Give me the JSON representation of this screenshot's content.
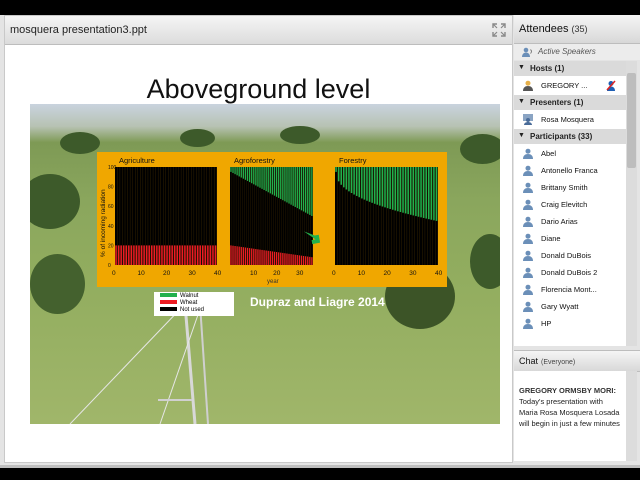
{
  "presentation": {
    "file_title": "mosquera presentation3.ppt",
    "slide_title": "Aboveground level",
    "citation": "Dupraz and Liagre 2014",
    "legend": [
      {
        "label": "Walnut",
        "color": "#22b14c"
      },
      {
        "label": "Wheat",
        "color": "#ed1c24"
      },
      {
        "label": "Not used",
        "color": "#000000"
      }
    ]
  },
  "chart_data": {
    "type": "bar",
    "ylabel": "% of incoming radiation",
    "xlabel": "year",
    "panels": [
      {
        "title": "Agriculture",
        "x_ticks": [
          "0",
          "10",
          "20",
          "30",
          "40"
        ]
      },
      {
        "title": "Agroforestry",
        "x_ticks": [
          "10",
          "20",
          "30"
        ]
      },
      {
        "title": "Forestry",
        "x_ticks": [
          "0",
          "10",
          "20",
          "30",
          "40"
        ]
      }
    ],
    "y_ticks": [
      "0",
      "20",
      "40",
      "60",
      "80",
      "100"
    ],
    "series_colors": {
      "walnut": "#22b14c",
      "wheat": "#ed1c24",
      "not_used": "#000000"
    }
  },
  "attendees": {
    "title": "Attendees",
    "count": "(35)",
    "active_speakers": "Active Speakers",
    "sections": [
      {
        "label": "Hosts (1)",
        "people": [
          "GREGORY ..."
        ]
      },
      {
        "label": "Presenters (1)",
        "people": [
          "Rosa Mosquera"
        ]
      },
      {
        "label": "Participants (33)",
        "people": [
          "Abel",
          "Antonello Franca",
          "Brittany Smith",
          "Craig Elevitch",
          "Dario Arias",
          "Diane",
          "Donald DuBois",
          "Donald DuBois 2",
          "Florencia Mont...",
          "Gary Wyatt",
          "HP"
        ]
      }
    ]
  },
  "chat": {
    "title": "Chat",
    "scope": "(Everyone)",
    "sender": "GREGORY ORMSBY MORI:",
    "message": "Today's presentation with Maria Rosa Mosquera Losada will begin in just a few minutes"
  }
}
